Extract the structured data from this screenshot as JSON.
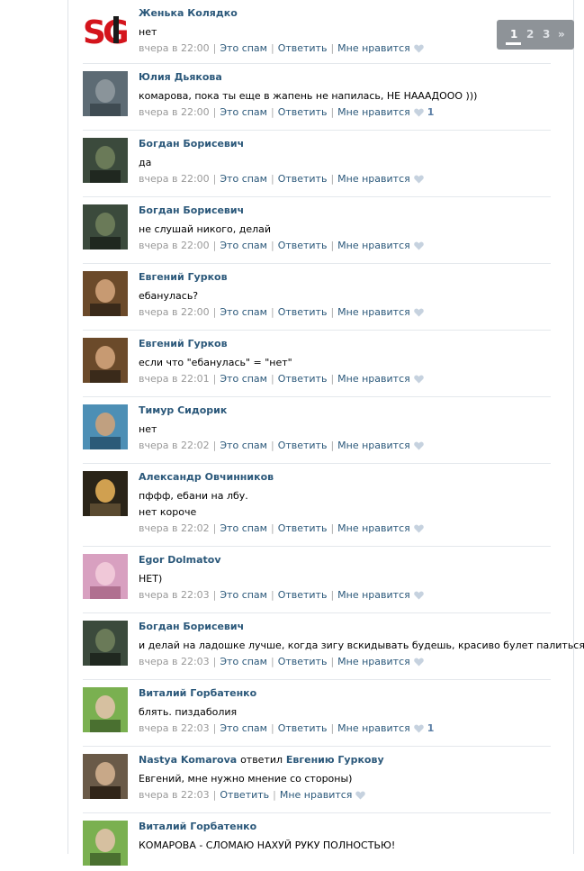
{
  "posts": [
    {
      "author": "Женька Колядко",
      "replied": "",
      "replied_to": "",
      "lines": [
        "нет"
      ],
      "time": "вчера в 22:00",
      "spam": "Это спам",
      "reply": "Ответить",
      "like": "Мне нравится",
      "likes": "",
      "avatar": "sg-logo-avatar"
    },
    {
      "author": "Юлия Дьякова",
      "replied": "",
      "replied_to": "",
      "lines": [
        "комарова, пока ты еще в жапень не напилась, НЕ НАААДООО )))"
      ],
      "time": "вчера в 22:00",
      "spam": "Это спам",
      "reply": "Ответить",
      "like": "Мне нравится",
      "likes": "1",
      "avatar": "photo-avatar"
    },
    {
      "author": "Богдан Борисевич",
      "replied": "",
      "replied_to": "",
      "lines": [
        "да"
      ],
      "time": "вчера в 22:00",
      "spam": "Это спам",
      "reply": "Ответить",
      "like": "Мне нравится",
      "likes": "",
      "avatar": "photo-avatar"
    },
    {
      "author": "Богдан Борисевич",
      "replied": "",
      "replied_to": "",
      "lines": [
        "не слушай никого, делай"
      ],
      "time": "вчера в 22:00",
      "spam": "Это спам",
      "reply": "Ответить",
      "like": "Мне нравится",
      "likes": "",
      "avatar": "photo-avatar"
    },
    {
      "author": "Евгений Гурков",
      "replied": "",
      "replied_to": "",
      "lines": [
        "ебанулась?"
      ],
      "time": "вчера в 22:00",
      "spam": "Это спам",
      "reply": "Ответить",
      "like": "Мне нравится",
      "likes": "",
      "avatar": "photo-avatar"
    },
    {
      "author": "Евгений Гурков",
      "replied": "",
      "replied_to": "",
      "lines": [
        "если что \"ебанулась\" = \"нет\""
      ],
      "time": "вчера в 22:01",
      "spam": "Это спам",
      "reply": "Ответить",
      "like": "Мне нравится",
      "likes": "",
      "avatar": "photo-avatar"
    },
    {
      "author": "Тимур Сидорик",
      "replied": "",
      "replied_to": "",
      "lines": [
        "нет"
      ],
      "time": "вчера в 22:02",
      "spam": "Это спам",
      "reply": "Ответить",
      "like": "Мне нравится",
      "likes": "",
      "avatar": "photo-avatar"
    },
    {
      "author": "Александр Овчинников",
      "replied": "",
      "replied_to": "",
      "lines": [
        "пффф, ебани на лбу.",
        "нет короче"
      ],
      "time": "вчера в 22:02",
      "spam": "Это спам",
      "reply": "Ответить",
      "like": "Мне нравится",
      "likes": "",
      "avatar": "photo-avatar"
    },
    {
      "author": "Egor Dolmatov",
      "replied": "",
      "replied_to": "",
      "lines": [
        "НЕТ)"
      ],
      "time": "вчера в 22:03",
      "spam": "Это спам",
      "reply": "Ответить",
      "like": "Мне нравится",
      "likes": "",
      "avatar": "photo-avatar"
    },
    {
      "author": "Богдан Борисевич",
      "replied": "",
      "replied_to": "",
      "lines": [
        "и делай на ладошке лучше, когда зигу вскидывать будешь, красиво булет палиться)))))"
      ],
      "time": "вчера в 22:03",
      "spam": "Это спам",
      "reply": "Ответить",
      "like": "Мне нравится",
      "likes": "",
      "avatar": "photo-avatar"
    },
    {
      "author": "Виталий Горбатенко",
      "replied": "",
      "replied_to": "",
      "lines": [
        "блять. пиздаболия"
      ],
      "time": "вчера в 22:03",
      "spam": "Это спам",
      "reply": "Ответить",
      "like": "Мне нравится",
      "likes": "1",
      "avatar": "photo-avatar"
    },
    {
      "author": "Nastya Komarova",
      "replied": "ответил",
      "replied_to": "Евгению Гуркову",
      "lines": [
        "Евгений, мне нужно мнение со стороны)"
      ],
      "time": "вчера в 22:03",
      "spam": "",
      "reply": "Ответить",
      "like": "Мне нравится",
      "likes": "",
      "avatar": "photo-avatar"
    },
    {
      "author": "Виталий Горбатенко",
      "replied": "",
      "replied_to": "",
      "lines": [
        "КОМАРОВА - СЛОМАЮ НАХУЙ РУКУ ПОЛНОСТЬЮ!"
      ],
      "time": "",
      "spam": "",
      "reply": "",
      "like": "",
      "likes": "",
      "avatar": "photo-avatar"
    }
  ],
  "pager": {
    "pages": [
      "1",
      "2",
      "3"
    ],
    "current": "1",
    "next": "»"
  },
  "colors": {
    "link": "#2b587a",
    "meta": "#999999",
    "divider": "#e4e8ec",
    "pager_bg": "#8e9398"
  }
}
